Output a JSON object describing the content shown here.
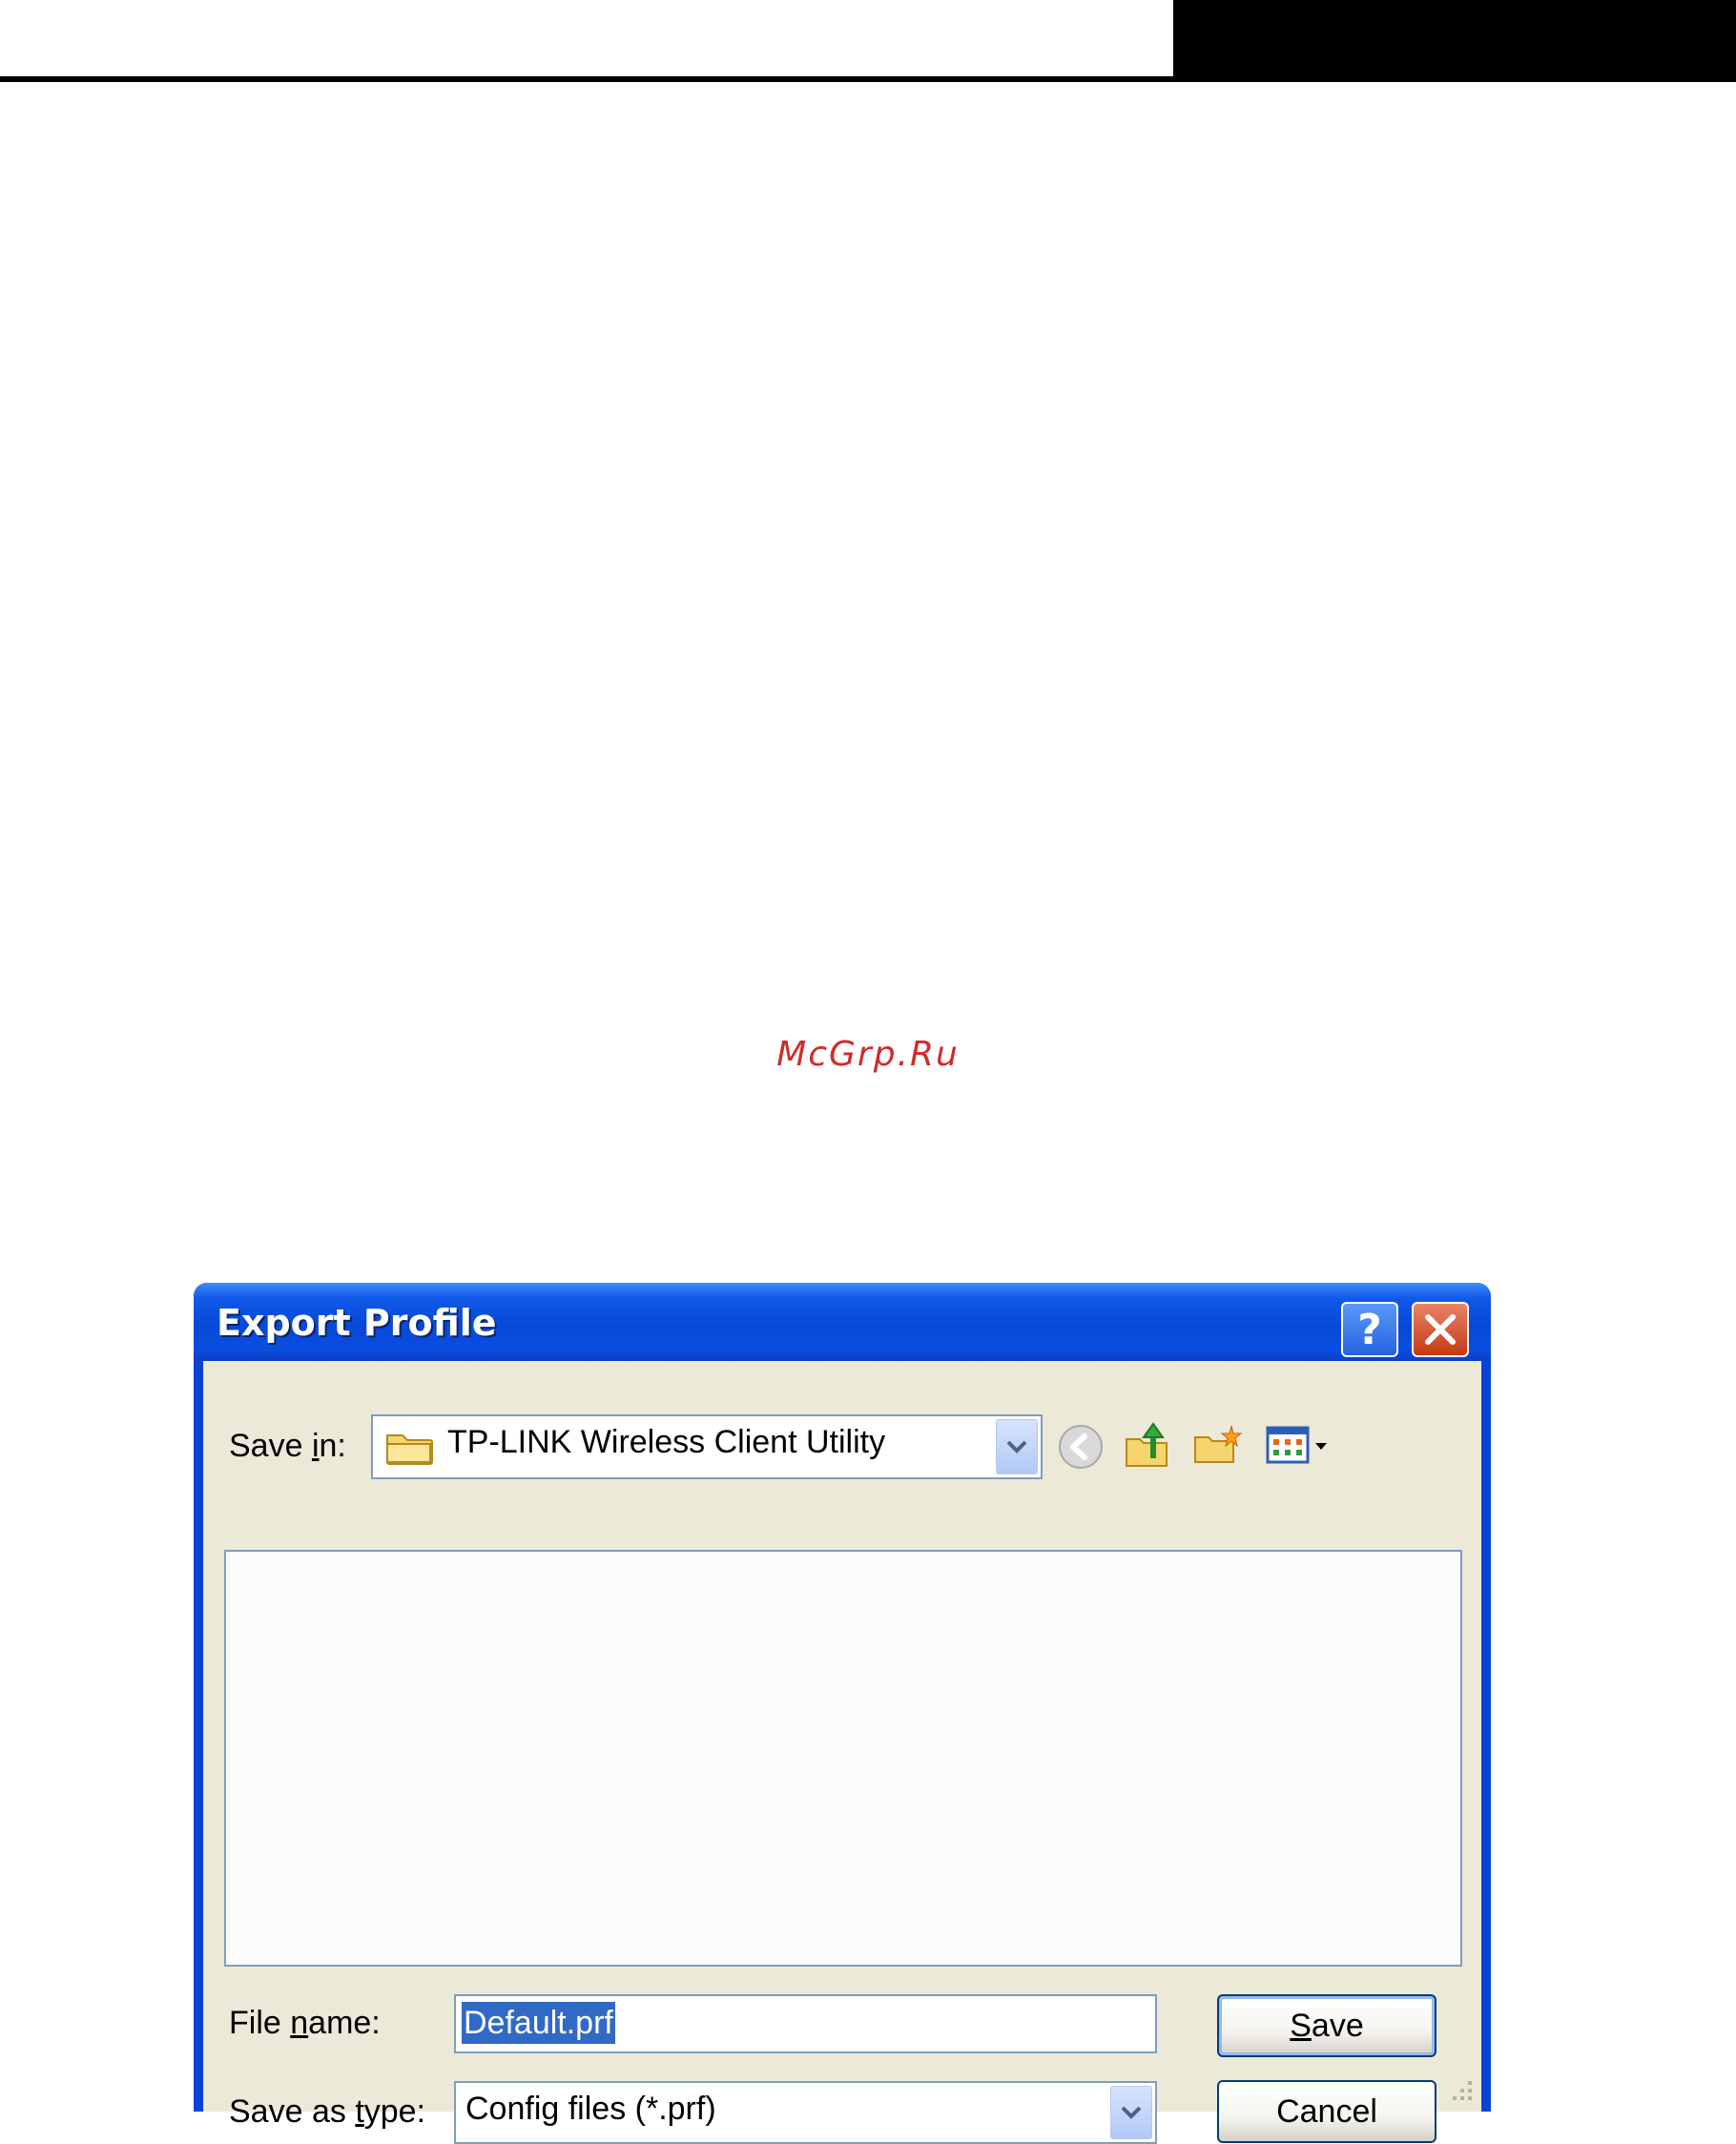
{
  "watermark": "McGrp.Ru",
  "dialog": {
    "title": "Export Profile",
    "help_label": "?",
    "save_in": {
      "label": "Save in:",
      "label_pre": "Save ",
      "label_accel": "i",
      "label_post": "n:",
      "value": "TP-LINK Wireless Client Utility"
    },
    "toolbar_icons": [
      "back-icon",
      "up-folder-icon",
      "new-folder-icon",
      "view-menu-icon"
    ],
    "file_name": {
      "label": "File name:",
      "label_pre": "File ",
      "label_accel": "n",
      "label_post": "ame:",
      "value": "Default.prf"
    },
    "save_as_type": {
      "label": "Save as type:",
      "label_pre": "Save as ",
      "label_accel": "t",
      "label_post": "ype:",
      "value": "Config files (*.prf)"
    },
    "save_button": {
      "label": "Save",
      "accel": "S",
      "rest": "ave"
    },
    "cancel_button": {
      "label": "Cancel"
    }
  },
  "colors": {
    "title_bar": "#0a4ee0",
    "client_bg": "#ece9d8",
    "selection": "#316ac5",
    "watermark": "#d02b2b"
  }
}
